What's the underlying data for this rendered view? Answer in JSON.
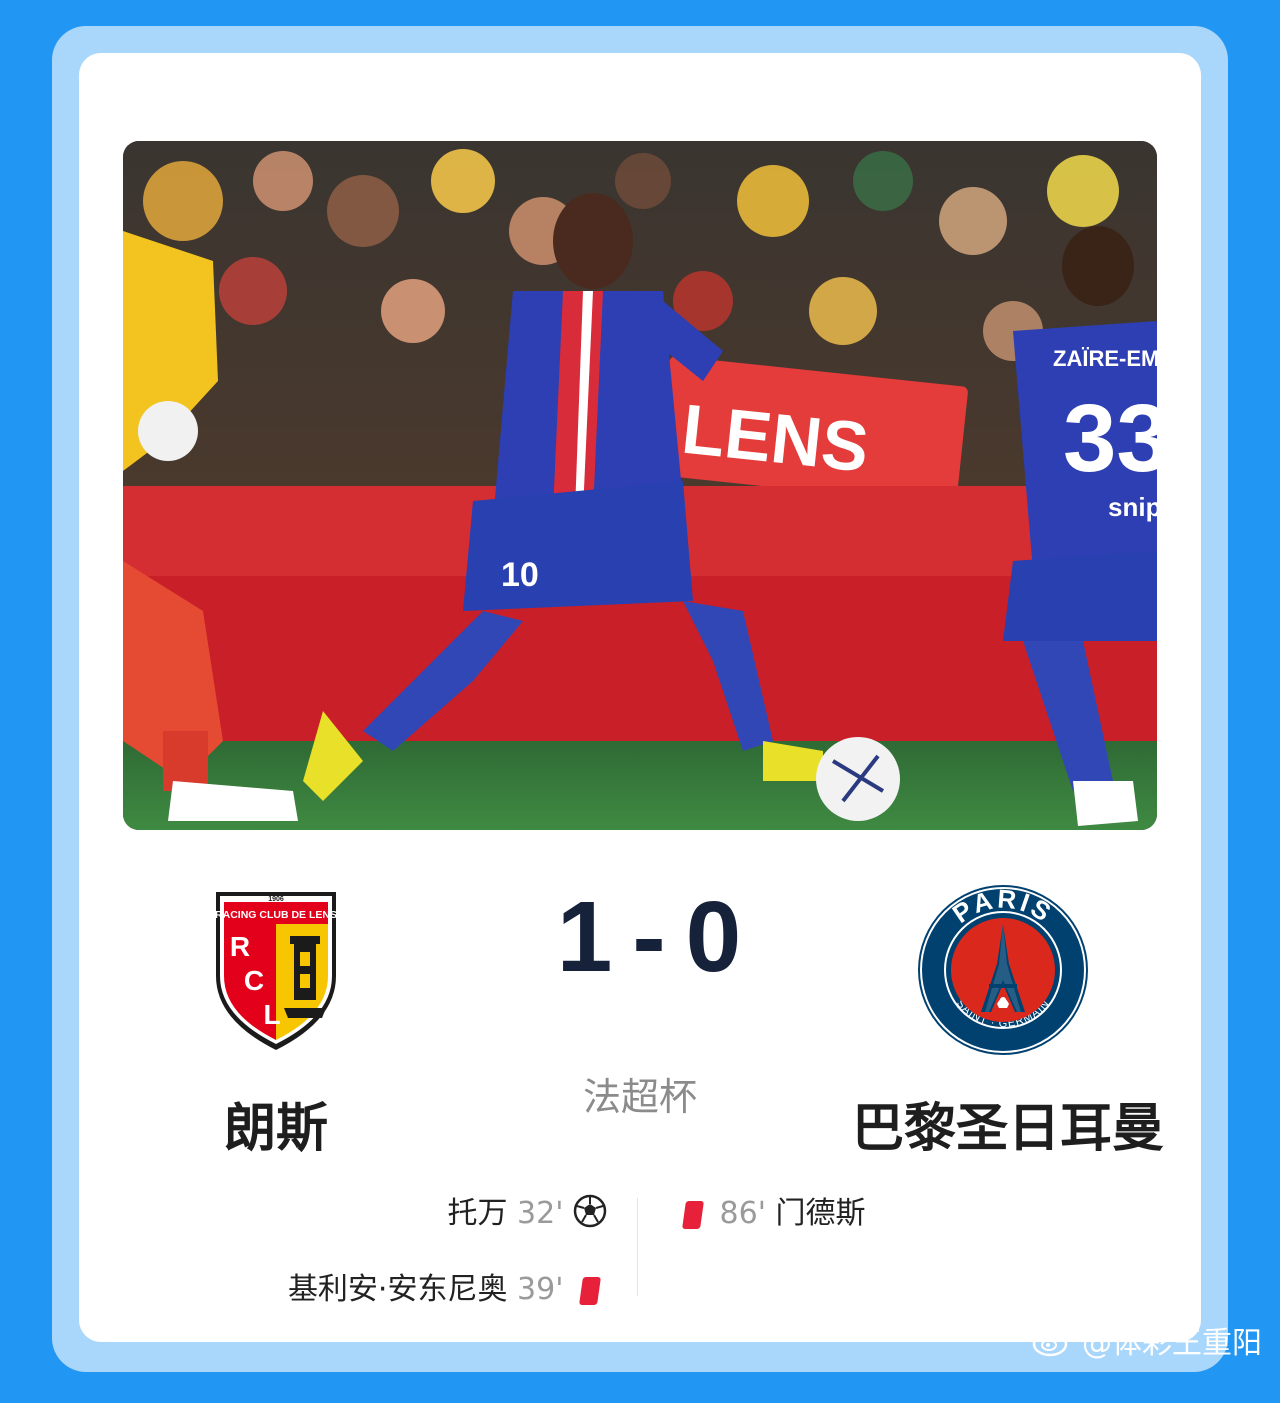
{
  "match": {
    "home_team": "朗斯",
    "away_team": "巴黎圣日耳曼",
    "home_score": "1",
    "away_score": "0",
    "score_separator": "-",
    "competition": "法超杯"
  },
  "home_crest": {
    "icon": "rc-lens-crest-icon",
    "year": "1906",
    "name": "RACING CLUB DE LENS",
    "letters": [
      "R",
      "C",
      "L"
    ],
    "colors": {
      "red": "#e2001a",
      "gold": "#f7c600"
    }
  },
  "away_crest": {
    "icon": "psg-crest-icon",
    "top_text": "PARIS",
    "bottom_text": "SAINT · GERMAIN",
    "colors": {
      "navy": "#004170",
      "red": "#da291c"
    }
  },
  "photo": {
    "banner_text": "LENS",
    "jersey_left_number": "10",
    "jersey_right_name": "ZAÏRE-EMER",
    "jersey_right_number": "33",
    "sponsor_text": "snip"
  },
  "events": {
    "home": [
      {
        "player": "托万",
        "minute": "32'",
        "type": "goal",
        "icon": "soccer-ball-icon"
      },
      {
        "player": "基利安·安东尼奥",
        "minute": "39'",
        "type": "red-card",
        "icon": "red-card-icon"
      }
    ],
    "away": [
      {
        "player": "门德斯",
        "minute": "86'",
        "type": "red-card",
        "icon": "red-card-icon"
      }
    ]
  },
  "watermark": {
    "text": "@体彩王重阳",
    "icon": "weibo-logo-icon"
  },
  "colors": {
    "page_background": "#2196f3",
    "frame": "#a9d6fb",
    "card": "#ffffff",
    "score": "#16213a",
    "red_card": "#e8213a"
  }
}
